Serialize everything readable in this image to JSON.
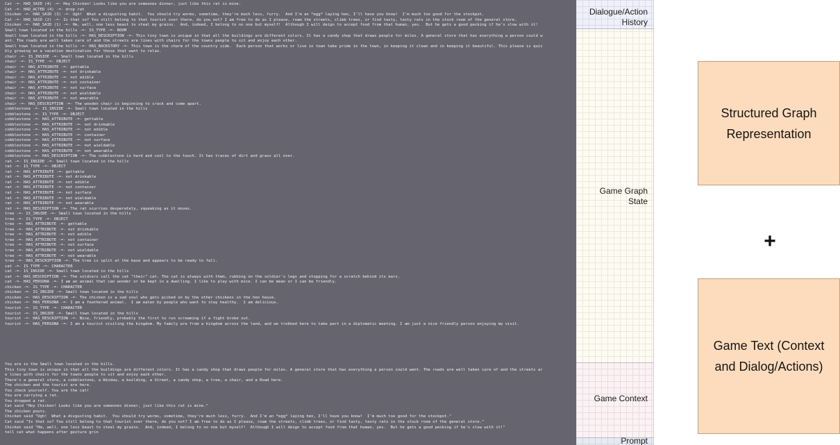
{
  "history_lines": [
    "Cat -=- HAD_SAID (4) -=- Hey Chicken! Looks like you are someones dinner, just like this rat is mine.",
    "Cat -=- HAD_ACTED (4) -=- drop rat",
    "Chicken -=- HAD_SAID (3) -=- Ugh!  What a disgusting habit.  You should try worms, sometime, they're much less, furry.  And I'm an *egg* laying hen, I'll have you know!  I'm much too good for the stockpot.",
    "Cat -=- HAD_SAID (2) -=- Is that so? You still belong to that tourist over there, do you not? I am free to do as I please, roam the streets, climb trees, or find tasty, tasty rats in the stock room of the general store.",
    "Chicken -=- HAD_SAID (1) -=- Hm, well, one less beast to steal my grains.  And, indeed, I belong to no one but myself!  Although I will deign to accept food from that human, yes.  But he gets a good pecking if he's slow with it!"
  ],
  "graph_lines": [
    "Small town located in the hills -=- IS_TYPE -=- ROOM",
    "Small town located in the hills -=- HAS_DESCRIPTION -=- This tiny town is unique in that all the buildings are different colors. It has a candy shop that draws people for miles. A general store that has everything a person could w",
    "ant. The roads are well taken care of and the streets are lines with chairs for the towns people to sit and enjoy each other.",
    "Small town located in the hills -=- HAS_BACKSTORY -=- This town is the charm of the country side.  Each person that works or live in town take pride in the town, in keeping it clean and in keeping it beautiful. This please is quic",
    "kly growing as a vacation destination for those that want to relax.",
    "chair -=- IS_INSIDE -=- Small town located in the hills",
    "chair -=- IS_TYPE -=- OBJECT",
    "chair -=- HAS_ATTRIBUTE -=- gettable",
    "chair -=- HAS_ATTRIBUTE -=- not drinkable",
    "chair -=- HAS_ATTRIBUTE -=- not edible",
    "chair -=- HAS_ATTRIBUTE -=- not container",
    "chair -=- HAS_ATTRIBUTE -=- not surface",
    "chair -=- HAS_ATTRIBUTE -=- not wieldable",
    "chair -=- HAS_ATTRIBUTE -=- not wearable",
    "chair -=- HAS_DESCRIPTION -=- The wooden chair is beginning to crack and come apart.",
    "cobblestone -=- IS_INSIDE -=- Small town located in the hills",
    "cobblestone -=- IS_TYPE -=- OBJECT",
    "cobblestone -=- HAS_ATTRIBUTE -=- gettable",
    "cobblestone -=- HAS_ATTRIBUTE -=- not drinkable",
    "cobblestone -=- HAS_ATTRIBUTE -=- not edible",
    "cobblestone -=- HAS_ATTRIBUTE -=- container",
    "cobblestone -=- HAS_ATTRIBUTE -=- not surface",
    "cobblestone -=- HAS_ATTRIBUTE -=- not wieldable",
    "cobblestone -=- HAS_ATTRIBUTE -=- not wearable",
    "cobblestone -=- HAS_DESCRIPTION -=- The cobblestone is hard and cool to the touch. It has traces of dirt and grass all over.",
    "rat -=- IS_INSIDE -=- Small town located in the hills",
    "rat -=- IS_TYPE -=- OBJECT",
    "rat -=- HAS_ATTRIBUTE -=- gettable",
    "rat -=- HAS_ATTRIBUTE -=- not drinkable",
    "rat -=- HAS_ATTRIBUTE -=- not edible",
    "rat -=- HAS_ATTRIBUTE -=- not container",
    "rat -=- HAS_ATTRIBUTE -=- not surface",
    "rat -=- HAS_ATTRIBUTE -=- not wieldable",
    "rat -=- HAS_ATTRIBUTE -=- not wearable",
    "rat -=- HAS_DESCRIPTION -=- The rat scurries desperately, squeaking as it moves.",
    "tree -=- IS_INSIDE -=- Small town located in the hills",
    "tree -=- IS_TYPE -=- OBJECT",
    "tree -=- HAS_ATTRIBUTE -=- gettable",
    "tree -=- HAS_ATTRIBUTE -=- not drinkable",
    "tree -=- HAS_ATTRIBUTE -=- not edible",
    "tree -=- HAS_ATTRIBUTE -=- not container",
    "tree -=- HAS_ATTRIBUTE -=- not surface",
    "tree -=- HAS_ATTRIBUTE -=- not wieldable",
    "tree -=- HAS_ATTRIBUTE -=- not wearable",
    "tree -=- HAS_DESCRIPTION -=- The tree is split at the base and appears to be ready to fall.",
    "cat -=- IS_TYPE -=- CHARACTER",
    "cat -=- IS_INSIDE -=- Small town located in the hills",
    "cat -=- HAS_DESCRIPTION -=- The soldiers call the cat \"their\" cat. The cat is always with them, rubbing on the soldier's legs and stopping for a scratch behind its ears.",
    "cat -=- HAS_PERSONA -=- I am an animal that can wonder or be kept in a dwelling. I like to play with mice. I can be mean or I can be friendly.",
    "chicken -=- IS_TYPE -=- CHARACTER",
    "chicken -=- IS_INSIDE -=- Small town located in the hills",
    "chicken -=- HAS_DESCRIPTION -=- The chicken is a sad soul who gets picked on by the other chickens in the hen house.",
    "chicken -=- HAS_PERSONA -=- I am a feathered animal.  I am eaten by people who want to stay healthy.  I am delicious.",
    "tourist -=- IS_TYPE -=- CHARACTER",
    "tourist -=- IS_INSIDE -=- Small town located in the hills",
    "tourist -=- HAS_DESCRIPTION -=- Nice, friendly, probably the first to run screaming if a fight broke out.",
    "tourist -=- HAS_PERSONA -=- I am a tourist visiting the kingdom. My family are from a kingdom across the land, and we trekked here to take part in a diplomatic meeting. I am just a nice friendly person enjoying my visit."
  ],
  "context_lines": [
    "You are in the Small town located in the hills.",
    "This tiny town is unique in that all the buildings are different colors. It has a candy shop that draws people for miles. A general store that has everything a person could want. The roads are well taken care of and the streets ar",
    "e lines with chairs for the towns people to sit and enjoy each other.",
    "There's a general store, a cobblestone, a Window, a building, a Street, a candy shop, a tree, a chair, and a Road here.",
    "The chicken and the tourist are here.",
    "You check yourself. You are the cat!",
    "You are carrying a rat.",
    "You dropped a rat.",
    "Cat said \"Hey Chicken! Looks like you are someones dinner, just like this rat is mine.\"",
    "The chicken pouts.",
    "Chicken said \"Ugh!  What a disgusting habit.  You should try worms, sometime, they're much less, furry.  And I'm an *egg* laying hen, I'll have you know!  I'm much too good for the stockpot.\"",
    "Cat said \"Is that so? You still belong to that tourist over there, do you not? I am free to do as I please, roam the streets, climb trees, or find tasty, tasty rats in the stock room of the general store.\"",
    "Chicken said \"Hm, well, one less beast to steal my grains.  And, indeed, I belong to no one but myself!  Although I will deign to accept food from that human, yes.  But he gets a good pecking if he's slow with it!\"",
    "tell cat what happens after gesture grin"
  ],
  "section_labels": {
    "history_line1": "Dialogue/Action",
    "history_line2": "History",
    "graph_line1": "Game Graph",
    "graph_line2": "State",
    "context": "Game Context",
    "prompt": "Prompt"
  },
  "boxes": {
    "structured_line1": "Structured Graph",
    "structured_line2": "Representation",
    "text_line1": "Game Text (Context",
    "text_line2": "and Dialog/Actions)"
  },
  "plus_sign": "+",
  "colors": {
    "panel_bg": "#66656f",
    "panel_text": "#f1f1f3",
    "box_fill": "#fcdcbc",
    "box_border": "#c99c6e"
  }
}
